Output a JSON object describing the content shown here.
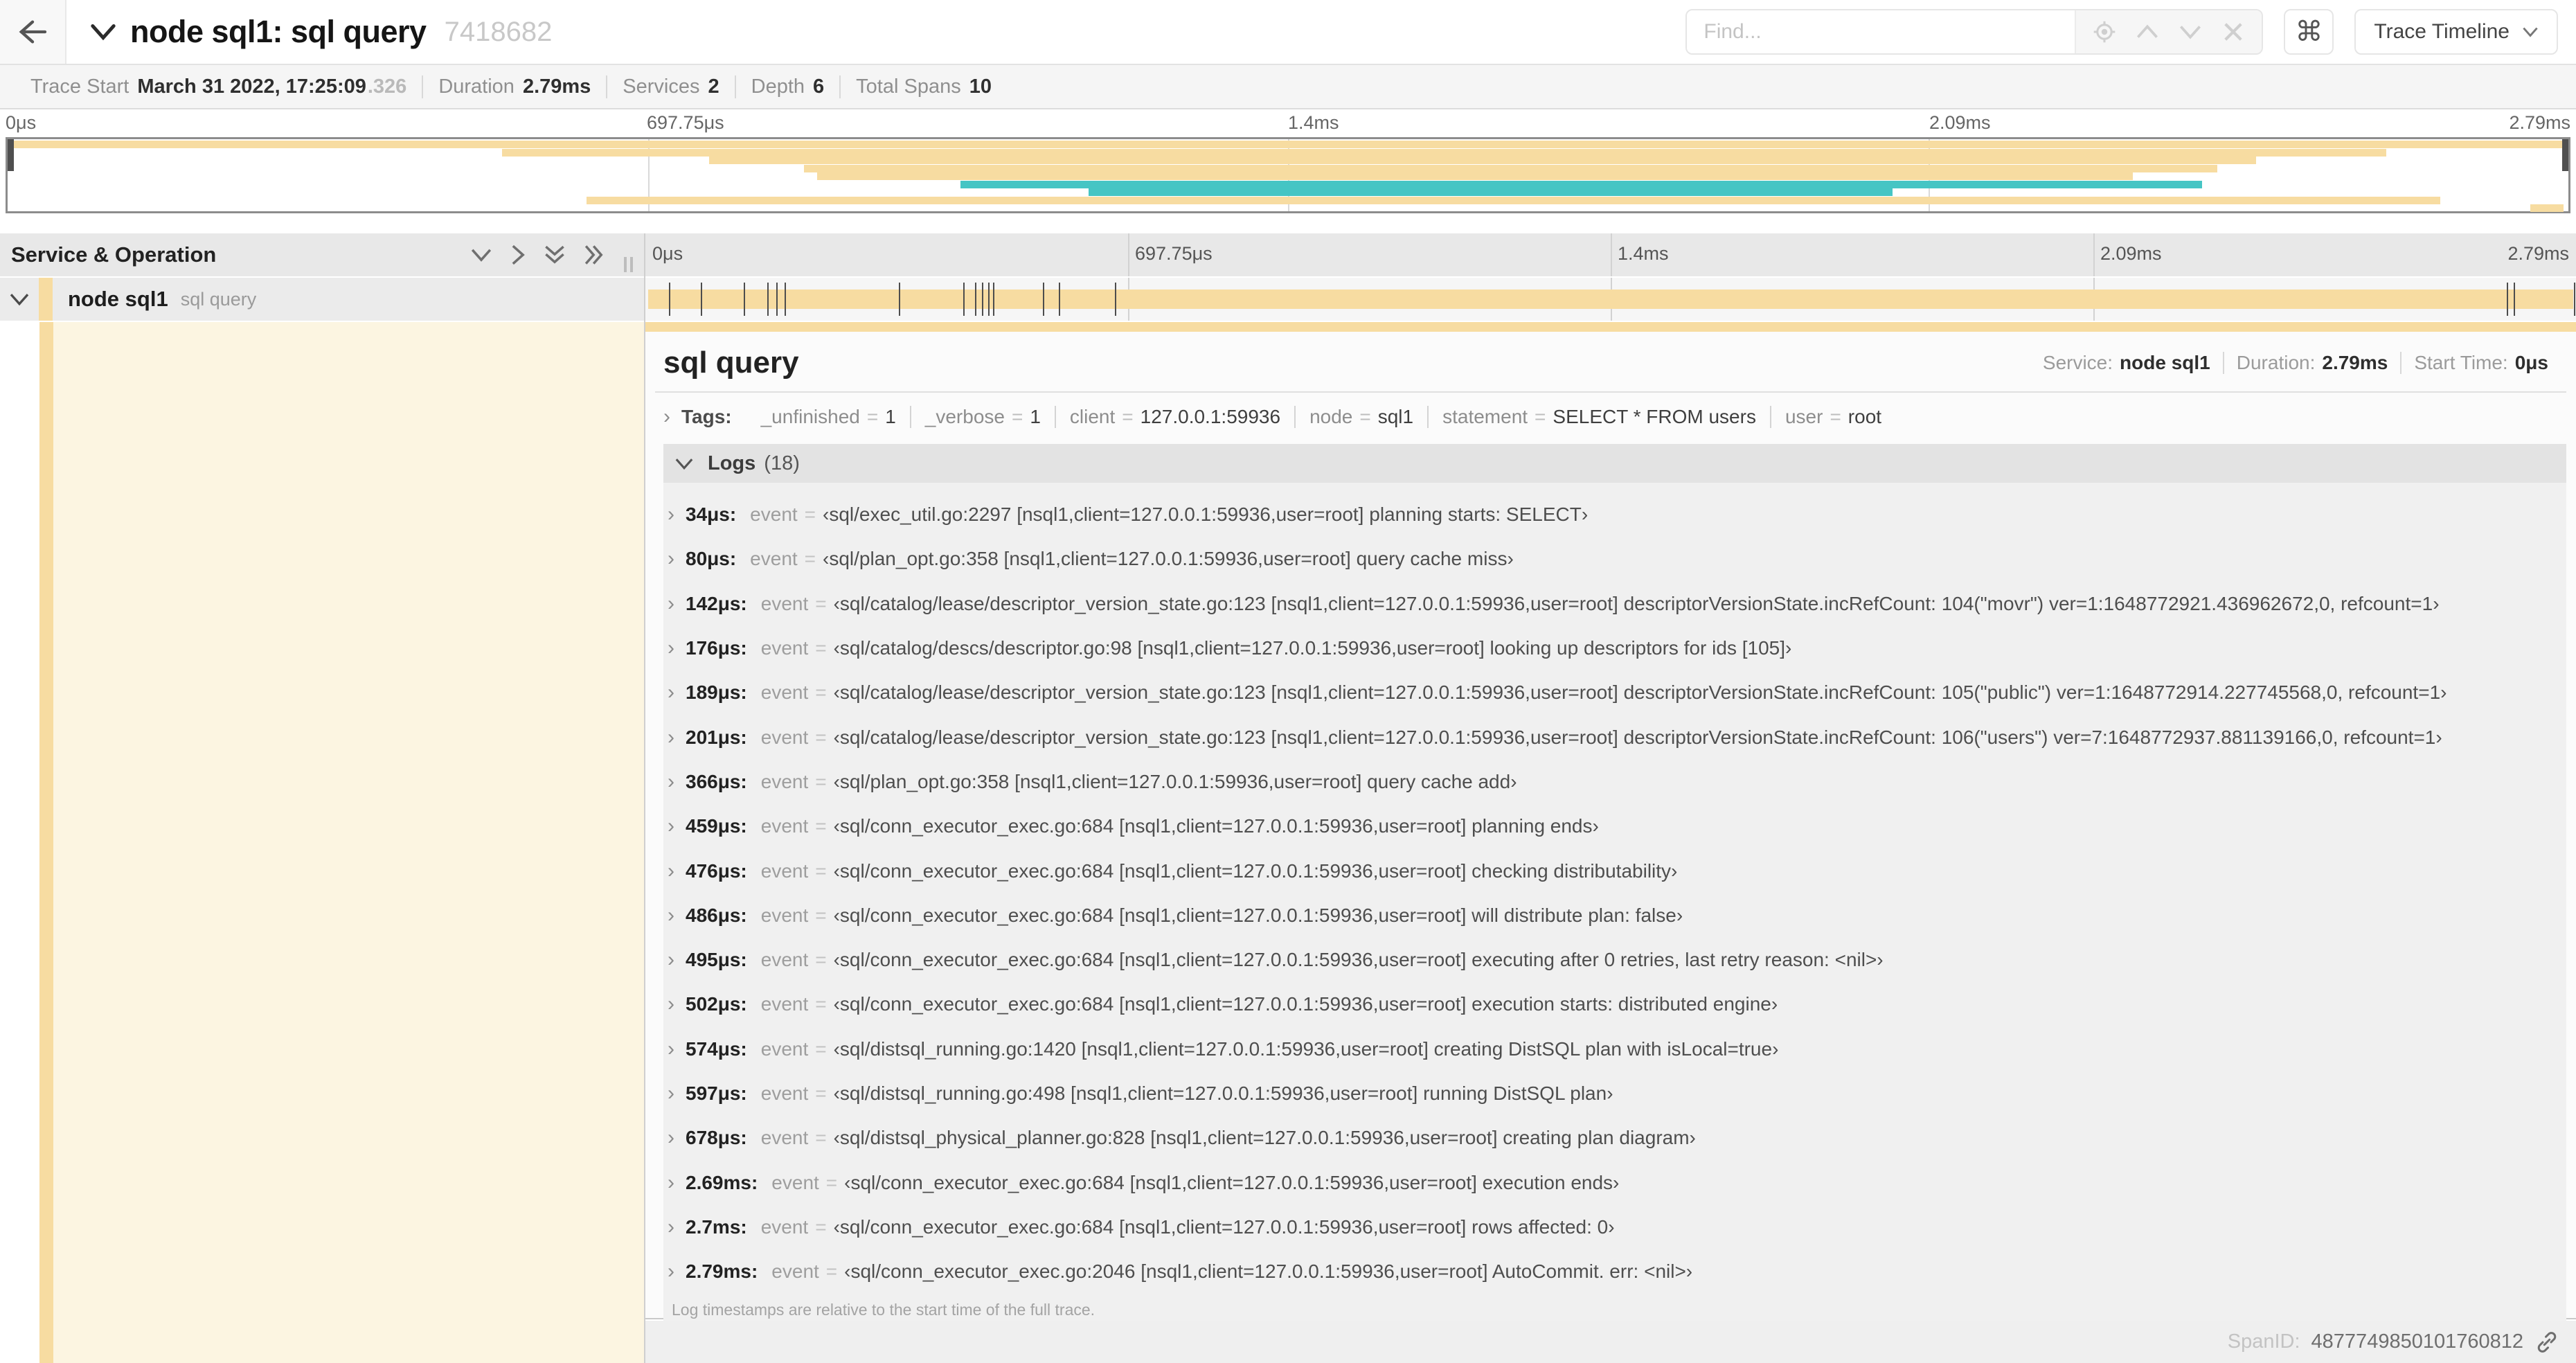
{
  "colors": {
    "tan": "#f7dca1",
    "teal": "#45c5c4",
    "cream": "#fcf5e1"
  },
  "header": {
    "title": "node sql1: sql query",
    "trace_id_short": "7418682",
    "find_placeholder": "Find...",
    "shortcut_glyph": "⌘",
    "view_select_label": "Trace Timeline"
  },
  "trace_info": {
    "trace_start": {
      "label": "Trace Start",
      "value": "March 31 2022, 17:25:09",
      "fraction": ".326"
    },
    "duration": {
      "label": "Duration",
      "value": "2.79ms"
    },
    "services": {
      "label": "Services",
      "value": "2"
    },
    "depth": {
      "label": "Depth",
      "value": "6"
    },
    "total_spans": {
      "label": "Total Spans",
      "value": "10"
    }
  },
  "minimap": {
    "labels": [
      {
        "label": "0μs",
        "pos": 0,
        "align": "left"
      },
      {
        "label": "697.75μs",
        "pos": 25,
        "align": "left"
      },
      {
        "label": "1.4ms",
        "pos": 50,
        "align": "left"
      },
      {
        "label": "2.09ms",
        "pos": 75,
        "align": "left"
      },
      {
        "label": "2.79ms",
        "pos": 100,
        "align": "right"
      }
    ],
    "spans": [
      {
        "row": 0,
        "start": 0,
        "end": 99.8,
        "color": "tan"
      },
      {
        "row": 1,
        "start": 19.3,
        "end": 92.9,
        "color": "tan"
      },
      {
        "row": 2,
        "start": 27.4,
        "end": 87.8,
        "color": "tan"
      },
      {
        "row": 3,
        "start": 31.1,
        "end": 86.3,
        "color": "tan"
      },
      {
        "row": 4,
        "start": 31.6,
        "end": 83.0,
        "color": "tan"
      },
      {
        "row": 5,
        "start": 37.2,
        "end": 85.7,
        "color": "teal"
      },
      {
        "row": 6,
        "start": 42.2,
        "end": 73.6,
        "color": "teal"
      },
      {
        "row": 7,
        "start": 22.6,
        "end": 95.0,
        "color": "tan"
      },
      {
        "row": 8,
        "start": 98.5,
        "end": 99.8,
        "color": "tan"
      }
    ]
  },
  "timeline": {
    "left_header": "Service & Operation",
    "total_us": 2790,
    "ruler_labels": [
      {
        "label": "0μs",
        "pos": 0,
        "align": "left"
      },
      {
        "label": "697.75μs",
        "pos": 25,
        "align": "left"
      },
      {
        "label": "1.4ms",
        "pos": 50,
        "align": "left"
      },
      {
        "label": "2.09ms",
        "pos": 75,
        "align": "left"
      },
      {
        "label": "2.79ms",
        "pos": 100,
        "align": "right"
      }
    ]
  },
  "span_row": {
    "service": "node sql1",
    "operation": "sql query",
    "tick_times_us": [
      34,
      80,
      142,
      176,
      189,
      201,
      366,
      459,
      476,
      486,
      495,
      502,
      574,
      597,
      678,
      2690,
      2700,
      2788
    ]
  },
  "detail": {
    "title": "sql query",
    "service_label": "Service:",
    "service": "node sql1",
    "duration_label": "Duration:",
    "duration": "2.79ms",
    "start_time_label": "Start Time:",
    "start_time": "0μs",
    "eq": "=",
    "tags": {
      "label": "Tags:",
      "items": [
        {
          "key": "_unfinished",
          "value": "1"
        },
        {
          "key": "_verbose",
          "value": "1"
        },
        {
          "key": "client",
          "value": "127.0.0.1:59936"
        },
        {
          "key": "node",
          "value": "sql1"
        },
        {
          "key": "statement",
          "value": "SELECT * FROM users"
        },
        {
          "key": "user",
          "value": "root"
        }
      ]
    },
    "logs": {
      "label": "Logs",
      "count": "(18)",
      "entries": [
        {
          "time": "34μs:",
          "field": "event",
          "value": "‹sql/exec_util.go:2297 [nsql1,client=127.0.0.1:59936,user=root] planning starts: SELECT›"
        },
        {
          "time": "80μs:",
          "field": "event",
          "value": "‹sql/plan_opt.go:358 [nsql1,client=127.0.0.1:59936,user=root] query cache miss›"
        },
        {
          "time": "142μs:",
          "field": "event",
          "value": "‹sql/catalog/lease/descriptor_version_state.go:123 [nsql1,client=127.0.0.1:59936,user=root] descriptorVersionState.incRefCount: 104(\"movr\") ver=1:1648772921.436962672,0, refcount=1›"
        },
        {
          "time": "176μs:",
          "field": "event",
          "value": "‹sql/catalog/descs/descriptor.go:98 [nsql1,client=127.0.0.1:59936,user=root] looking up descriptors for ids [105]›"
        },
        {
          "time": "189μs:",
          "field": "event",
          "value": "‹sql/catalog/lease/descriptor_version_state.go:123 [nsql1,client=127.0.0.1:59936,user=root] descriptorVersionState.incRefCount: 105(\"public\") ver=1:1648772914.227745568,0, refcount=1›"
        },
        {
          "time": "201μs:",
          "field": "event",
          "value": "‹sql/catalog/lease/descriptor_version_state.go:123 [nsql1,client=127.0.0.1:59936,user=root] descriptorVersionState.incRefCount: 106(\"users\") ver=7:1648772937.881139166,0, refcount=1›"
        },
        {
          "time": "366μs:",
          "field": "event",
          "value": "‹sql/plan_opt.go:358 [nsql1,client=127.0.0.1:59936,user=root] query cache add›"
        },
        {
          "time": "459μs:",
          "field": "event",
          "value": "‹sql/conn_executor_exec.go:684 [nsql1,client=127.0.0.1:59936,user=root] planning ends›"
        },
        {
          "time": "476μs:",
          "field": "event",
          "value": "‹sql/conn_executor_exec.go:684 [nsql1,client=127.0.0.1:59936,user=root] checking distributability›"
        },
        {
          "time": "486μs:",
          "field": "event",
          "value": "‹sql/conn_executor_exec.go:684 [nsql1,client=127.0.0.1:59936,user=root] will distribute plan: false›"
        },
        {
          "time": "495μs:",
          "field": "event",
          "value": "‹sql/conn_executor_exec.go:684 [nsql1,client=127.0.0.1:59936,user=root] executing after 0 retries, last retry reason: <nil>›"
        },
        {
          "time": "502μs:",
          "field": "event",
          "value": "‹sql/conn_executor_exec.go:684 [nsql1,client=127.0.0.1:59936,user=root] execution starts: distributed engine›"
        },
        {
          "time": "574μs:",
          "field": "event",
          "value": "‹sql/distsql_running.go:1420 [nsql1,client=127.0.0.1:59936,user=root] creating DistSQL plan with isLocal=true›"
        },
        {
          "time": "597μs:",
          "field": "event",
          "value": "‹sql/distsql_running.go:498 [nsql1,client=127.0.0.1:59936,user=root] running DistSQL plan›"
        },
        {
          "time": "678μs:",
          "field": "event",
          "value": "‹sql/distsql_physical_planner.go:828 [nsql1,client=127.0.0.1:59936,user=root] creating plan diagram›"
        },
        {
          "time": "2.69ms:",
          "field": "event",
          "value": "‹sql/conn_executor_exec.go:684 [nsql1,client=127.0.0.1:59936,user=root] execution ends›"
        },
        {
          "time": "2.7ms:",
          "field": "event",
          "value": "‹sql/conn_executor_exec.go:684 [nsql1,client=127.0.0.1:59936,user=root] rows affected: 0›"
        },
        {
          "time": "2.79ms:",
          "field": "event",
          "value": "‹sql/conn_executor_exec.go:2046 [nsql1,client=127.0.0.1:59936,user=root] AutoCommit. err: <nil>›"
        }
      ],
      "footnote": "Log timestamps are relative to the start time of the full trace."
    },
    "span_id_label": "SpanID:",
    "span_id": "4877749850101760812"
  }
}
